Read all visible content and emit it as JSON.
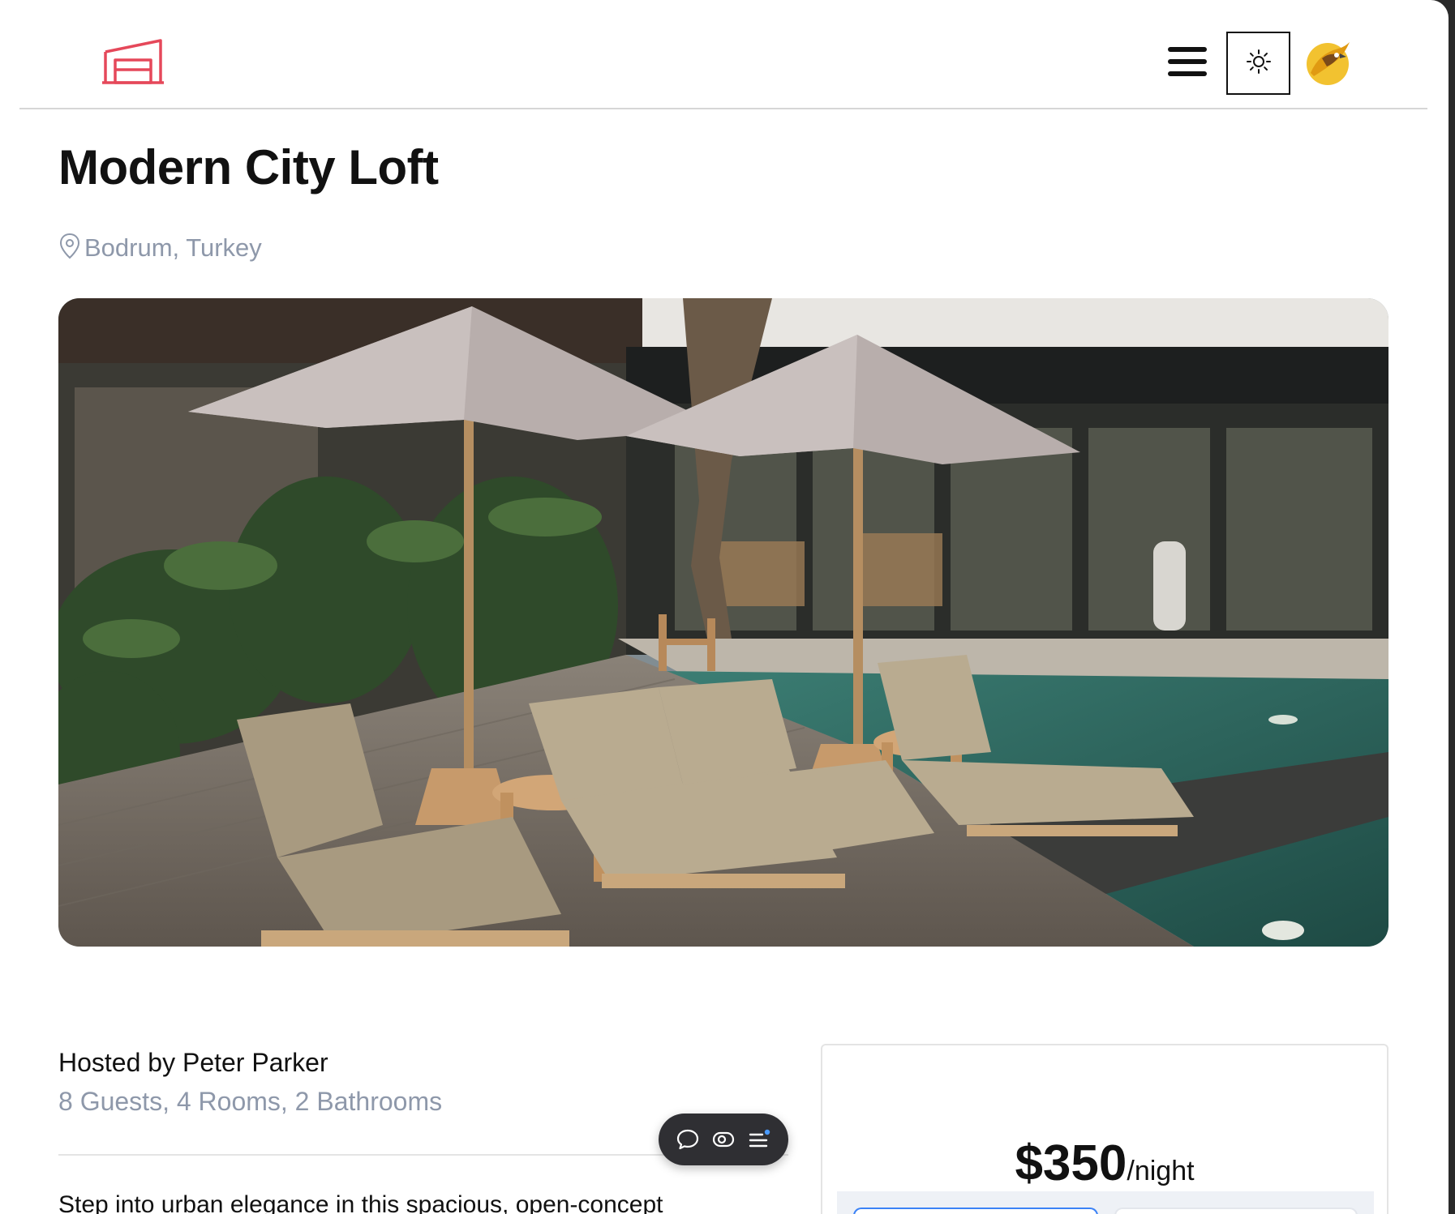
{
  "header": {
    "logo_icon": "garage-house-icon",
    "menu_icon": "hamburger-menu-icon",
    "theme_icon": "sun-icon",
    "avatar_icon": "user-avatar-icon",
    "accent_color": "#e5485a"
  },
  "listing": {
    "title": "Modern City Loft",
    "location_icon": "map-pin-icon",
    "location": "Bodrum, Turkey",
    "image_icon": "listing-photo-pool-umbrellas-loungers",
    "host_line": "Hosted by Peter Parker",
    "details_line": "8 Guests, 4 Rooms, 2 Bathrooms",
    "description": "Step into urban elegance in this spacious, open-concept"
  },
  "toolbar": {
    "items": [
      "chat-bubble-icon",
      "toggle-view-icon",
      "list-menu-icon"
    ]
  },
  "booking": {
    "price": "$350",
    "unit": "/night",
    "checkin_color": "#3b82f6"
  }
}
